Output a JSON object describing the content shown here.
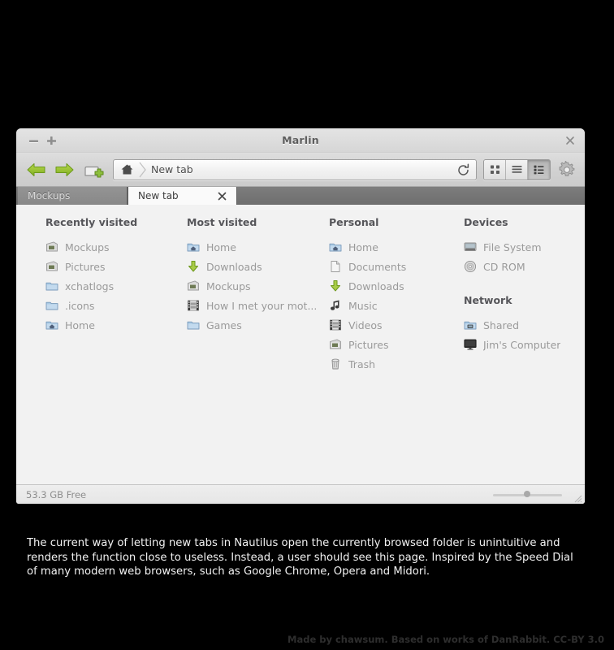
{
  "window": {
    "title": "Marlin",
    "controls": {
      "minimize": "minimize",
      "maximize": "maximize",
      "close": "close"
    }
  },
  "toolbar": {
    "back": "Back",
    "forward": "Forward",
    "new_tab": "New tab",
    "reload": "Reload",
    "breadcrumb": "New tab",
    "view_modes": [
      {
        "name": "icon-view",
        "active": false
      },
      {
        "name": "list-view",
        "active": false
      },
      {
        "name": "column-view",
        "active": true
      }
    ],
    "settings": "Settings"
  },
  "tabs": [
    {
      "label": "Mockups",
      "active": false,
      "closable": false
    },
    {
      "label": "New tab",
      "active": true,
      "closable": true,
      "close_glyph": "×"
    }
  ],
  "content": {
    "columns": [
      {
        "heading": "Recently visited",
        "items": [
          {
            "label": "Mockups",
            "icon": "pictures-folder-icon"
          },
          {
            "label": "Pictures",
            "icon": "pictures-folder-icon"
          },
          {
            "label": "xchatlogs",
            "icon": "folder-icon"
          },
          {
            "label": ".icons",
            "icon": "folder-icon"
          },
          {
            "label": "Home",
            "icon": "home-folder-icon"
          }
        ]
      },
      {
        "heading": "Most visited",
        "items": [
          {
            "label": "Home",
            "icon": "home-folder-icon"
          },
          {
            "label": "Downloads",
            "icon": "downloads-icon"
          },
          {
            "label": "Mockups",
            "icon": "pictures-folder-icon"
          },
          {
            "label": "How I met your mot...",
            "icon": "video-icon"
          },
          {
            "label": "Games",
            "icon": "folder-icon"
          }
        ]
      },
      {
        "heading": "Personal",
        "items": [
          {
            "label": "Home",
            "icon": "home-folder-icon"
          },
          {
            "label": "Documents",
            "icon": "document-icon"
          },
          {
            "label": "Downloads",
            "icon": "downloads-icon"
          },
          {
            "label": "Music",
            "icon": "music-note-icon"
          },
          {
            "label": "Videos",
            "icon": "video-icon"
          },
          {
            "label": "Pictures",
            "icon": "pictures-folder-icon"
          },
          {
            "label": "Trash",
            "icon": "trash-icon"
          }
        ]
      },
      {
        "heading": "Devices",
        "items": [
          {
            "label": "File System",
            "icon": "harddisk-icon"
          },
          {
            "label": "CD ROM",
            "icon": "cdrom-icon",
            "eject": true
          }
        ]
      },
      {
        "heading": "Network",
        "items": [
          {
            "label": "Shared",
            "icon": "shared-folder-icon"
          },
          {
            "label": "Jim's Computer",
            "icon": "computer-icon"
          }
        ]
      }
    ]
  },
  "statusbar": {
    "free_space": "53.3 GB Free",
    "zoom_value": 45
  },
  "caption": "The current way of letting new tabs in Nautilus open the currently browsed folder is unintuitive and renders the function close to useless. Instead, a user should see this page. Inspired by the Speed Dial of many modern web browsers, such as Google Chrome, Opera and Midori.",
  "credit": "Made by chawsum. Based on works of DanRabbit. CC-BY 3.0",
  "colors": {
    "accent_green": "#8cc63f",
    "window_bg": "#dcdcdc",
    "content_bg": "#f2f2f2",
    "tabstrip_bg": "#7d7d7d",
    "heading_text": "#56565a",
    "item_text": "#9a9a9a"
  }
}
